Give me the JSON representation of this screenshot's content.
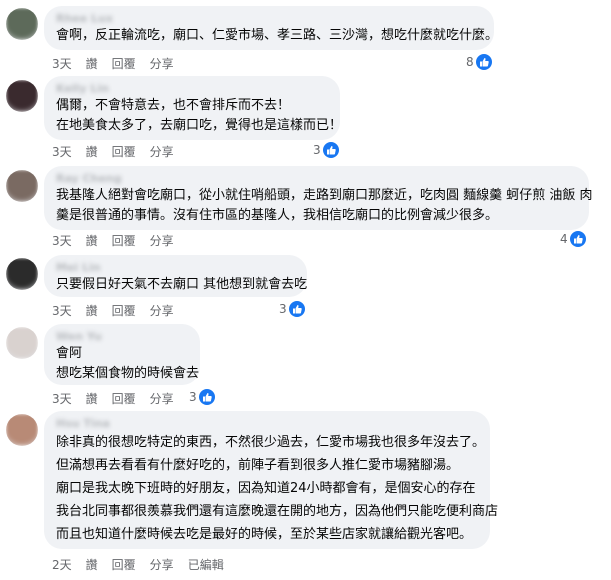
{
  "actions": {
    "reply": "回覆",
    "share": "分享",
    "edited": "已編輯"
  },
  "comments": [
    {
      "author": "Rhee Lux",
      "avatar_color": "#5d6a5a",
      "lines": [
        "會啊，反正輪流吃，廟口、仁愛市場、孝三路、三沙灣，想吃什麼就吃什麼。"
      ],
      "time": "3天",
      "like": "讚",
      "reactions": "8"
    },
    {
      "author": "Kelly Lin",
      "avatar_color": "#3a2a2e",
      "lines": [
        "偶爾，不會特意去，也不會排斥而不去！",
        "在地美食太多了，去廟口吃，覺得也是這樣而已！"
      ],
      "time": "3天",
      "like": "讚",
      "reactions": "3"
    },
    {
      "author": "Ray Cheng",
      "avatar_color": "#7a6a62",
      "lines": [
        "我基隆人絕對會吃廟口，從小就住哨船頭，走路到廟口那麼近，吃肉圓 麵線羹 蚵仔煎 油飯 肉",
        "羹是很普通的事情。沒有住市區的基隆人，我相信吃廟口的比例會減少很多。"
      ],
      "time": "3天",
      "like": "讚",
      "reactions": "4"
    },
    {
      "author": "Mei Lin",
      "avatar_color": "#2b2b2b",
      "lines": [
        "只要假日好天氣不去廟口 其他想到就會去吃"
      ],
      "time": "3天",
      "like": "讚",
      "reactions": "3"
    },
    {
      "author": "Wen Yu",
      "avatar_color": "#d9d2cf",
      "lines": [
        "會阿",
        "想吃某個食物的時候會去"
      ],
      "time": "3天",
      "like": "讚",
      "reactions": "3"
    },
    {
      "author": "Hsu Tina",
      "avatar_color": "#b88a76",
      "lines": [
        "除非真的很想吃特定的東西，不然很少過去，仁愛市場我也很多年沒去了。",
        "但滿想再去看看有什麼好吃的，前陣子看到很多人推仁愛市場豬腳湯。",
        "廟口是我太晚下班時的好朋友，因為知道24小時都會有，是個安心的存在",
        "我台北同事都很羨慕我們還有這麼晚還在開的地方，因為他們只能吃便利商店",
        "而且也知道什麼時候去吃是最好的時候，至於某些店家就讓給觀光客吧。"
      ],
      "time": "2天",
      "like": "讚"
    }
  ]
}
